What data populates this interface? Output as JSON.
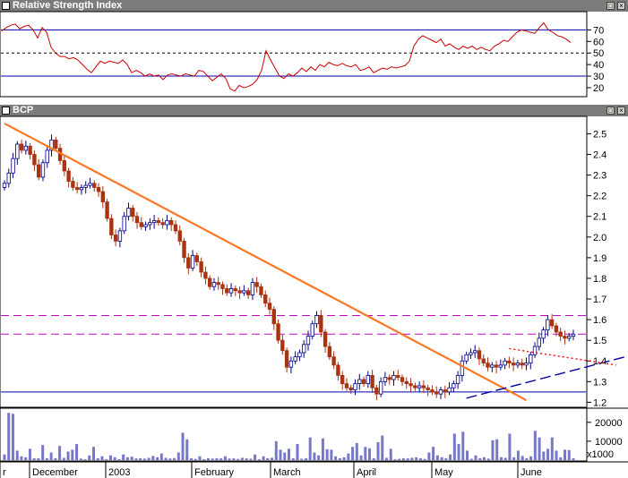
{
  "rsi_panel": {
    "title": "Relative Strength Index"
  },
  "price_panel": {
    "title": "BCP"
  },
  "window_buttons": {
    "restore": "□",
    "close": "×"
  },
  "volume_unit": "x1000",
  "colors": {
    "rsi_line": "#cc0000",
    "trend_line": "#ff7722",
    "resistance": "#cc00cc",
    "support": "#0000aa",
    "up_candle": "#ffffff",
    "down_candle": "#aa3311",
    "volume": "#7777cc"
  },
  "chart_data": [
    {
      "type": "line",
      "name": "Relative Strength Index",
      "title": "Relative Strength Index",
      "ylim": [
        13,
        85
      ],
      "yticks": [
        20,
        30,
        40,
        50,
        60,
        70
      ],
      "reference_lines": [
        30,
        50,
        70
      ],
      "x": [
        0,
        5,
        10,
        15,
        20,
        25,
        30,
        35,
        40,
        45,
        50,
        55,
        60,
        65,
        70,
        75,
        80,
        85,
        90,
        95,
        100,
        105,
        110,
        115,
        120,
        125,
        130,
        135,
        140,
        145,
        150,
        155,
        160,
        165,
        170,
        175,
        180,
        185,
        190,
        195,
        200,
        205,
        210,
        215,
        220,
        225,
        230,
        235,
        240,
        245,
        250,
        255,
        260,
        265,
        270,
        275,
        280,
        285,
        290,
        295,
        300,
        305,
        310,
        315,
        320,
        325,
        330,
        335,
        340,
        345,
        350,
        355,
        360,
        365,
        370,
        375,
        380,
        385,
        390,
        395,
        400,
        405,
        410,
        415,
        420,
        425,
        430,
        435,
        440,
        445,
        450,
        455,
        460,
        465,
        470,
        475,
        480,
        485,
        490,
        495,
        500,
        505,
        510,
        515,
        520,
        525,
        530,
        535,
        540,
        545,
        550,
        555,
        560,
        565,
        570,
        575,
        580,
        585,
        590,
        595,
        600,
        605,
        610,
        615,
        620,
        625,
        630,
        635
      ],
      "values": [
        69,
        72,
        74,
        75,
        71,
        73,
        74,
        70,
        63,
        72,
        68,
        55,
        50,
        47,
        47,
        45,
        46,
        44,
        40,
        36,
        33,
        38,
        43,
        41,
        43,
        42,
        41,
        44,
        40,
        33,
        35,
        33,
        30,
        32,
        30,
        31,
        27,
        31,
        32,
        31,
        30,
        32,
        31,
        30,
        35,
        34,
        30,
        26,
        29,
        32,
        28,
        19,
        17,
        22,
        20,
        21,
        23,
        27,
        35,
        52,
        44,
        37,
        30,
        28,
        32,
        30,
        33,
        37,
        34,
        38,
        35,
        40,
        38,
        42,
        40,
        39,
        41,
        39,
        38,
        40,
        35,
        36,
        38,
        33,
        35,
        37,
        36,
        38,
        37,
        38,
        39,
        43,
        56,
        62,
        65,
        63,
        61,
        59,
        62,
        56,
        58,
        55,
        53,
        56,
        54,
        56,
        53,
        55,
        53,
        52,
        56,
        58,
        61,
        60,
        64,
        68,
        70,
        69,
        68,
        67,
        72,
        76,
        70,
        68,
        65,
        64,
        62,
        59
      ]
    },
    {
      "type": "candlestick",
      "name": "BCP",
      "title": "BCP",
      "ylim": [
        1.18,
        2.58
      ],
      "yticks": [
        1.2,
        1.3,
        1.4,
        1.5,
        1.6,
        1.7,
        1.8,
        1.9,
        2.0,
        2.1,
        2.2,
        2.3,
        2.4,
        2.5
      ],
      "xlabels": [
        "r",
        "December",
        "2003",
        "February",
        "March",
        "April",
        "May",
        "June"
      ],
      "close": [
        2.26,
        2.31,
        2.38,
        2.45,
        2.42,
        2.44,
        2.4,
        2.35,
        2.29,
        2.36,
        2.42,
        2.47,
        2.43,
        2.37,
        2.32,
        2.27,
        2.24,
        2.23,
        2.24,
        2.25,
        2.26,
        2.24,
        2.22,
        2.17,
        2.09,
        2.01,
        1.98,
        2.03,
        2.1,
        2.14,
        2.1,
        2.07,
        2.05,
        2.06,
        2.07,
        2.08,
        2.07,
        2.06,
        2.08,
        2.06,
        2.03,
        1.98,
        1.9,
        1.85,
        1.91,
        1.88,
        1.83,
        1.8,
        1.76,
        1.78,
        1.77,
        1.75,
        1.73,
        1.75,
        1.74,
        1.73,
        1.74,
        1.72,
        1.78,
        1.76,
        1.72,
        1.68,
        1.65,
        1.58,
        1.5,
        1.45,
        1.37,
        1.4,
        1.42,
        1.44,
        1.48,
        1.52,
        1.58,
        1.62,
        1.54,
        1.47,
        1.42,
        1.38,
        1.33,
        1.29,
        1.27,
        1.26,
        1.29,
        1.31,
        1.29,
        1.33,
        1.27,
        1.24,
        1.3,
        1.32,
        1.31,
        1.33,
        1.32,
        1.3,
        1.29,
        1.28,
        1.27,
        1.28,
        1.27,
        1.26,
        1.25,
        1.24,
        1.26,
        1.25,
        1.27,
        1.29,
        1.33,
        1.4,
        1.43,
        1.44,
        1.45,
        1.41,
        1.39,
        1.37,
        1.38,
        1.37,
        1.38,
        1.4,
        1.39,
        1.38,
        1.39,
        1.38,
        1.39,
        1.43,
        1.47,
        1.51,
        1.55,
        1.6,
        1.57,
        1.54,
        1.52,
        1.51,
        1.52,
        1.53
      ],
      "resistance_lines": [
        1.62,
        1.53
      ],
      "support_line": 1.25,
      "trendlines": [
        {
          "from": [
            0,
            2.55
          ],
          "to": [
            122,
            1.21
          ],
          "style": "solid"
        },
        {
          "from": [
            108,
            1.22
          ],
          "to": [
            160,
            1.5
          ],
          "style": "dashed"
        },
        {
          "from": [
            118,
            1.46
          ],
          "to": [
            143,
            1.38
          ],
          "style": "dotted"
        }
      ]
    },
    {
      "type": "bar",
      "name": "Volume",
      "ylim": [
        0,
        27000
      ],
      "yticks": [
        10000,
        20000
      ],
      "ytick_labels": [
        "10000",
        "20000"
      ],
      "values": [
        3000,
        25000,
        24500,
        5000,
        2000,
        1500,
        6000,
        1000,
        1000,
        8000,
        1000,
        4000,
        1000,
        7500,
        1200,
        4500,
        5500,
        8500,
        800,
        500,
        2500,
        7000,
        1000,
        2000,
        500,
        2500,
        1500,
        500,
        3000,
        1500,
        1800,
        900,
        1000,
        800,
        1200,
        2200,
        1500,
        3500,
        1200,
        800,
        1100,
        4000,
        14500,
        11000,
        1000,
        600,
        2000,
        500,
        1000,
        800,
        1000,
        900,
        2000,
        800,
        900,
        600,
        1200,
        1000,
        700,
        3000,
        500,
        2000,
        1000,
        1200,
        10000,
        5500,
        4000,
        6000,
        1000,
        8500,
        700,
        1000,
        12000,
        4000,
        2500,
        11500,
        5800,
        5500,
        2000,
        1000,
        1500,
        3500,
        7000,
        9000,
        2500,
        7000,
        6200,
        1000,
        9500,
        13000,
        1200,
        6000,
        500,
        700,
        1000,
        900,
        1200,
        1500,
        1000,
        600,
        4000,
        7000,
        2500,
        1500,
        1000,
        3000,
        14000,
        8500,
        15000,
        5000,
        700,
        2500,
        1000,
        1500,
        800,
        10500,
        11000,
        1500,
        1200,
        14000,
        1500,
        5000,
        2200,
        1000,
        2000,
        15500,
        12000,
        4500,
        6000,
        12000,
        5000,
        1500,
        5500,
        5300,
        1000
      ]
    }
  ]
}
